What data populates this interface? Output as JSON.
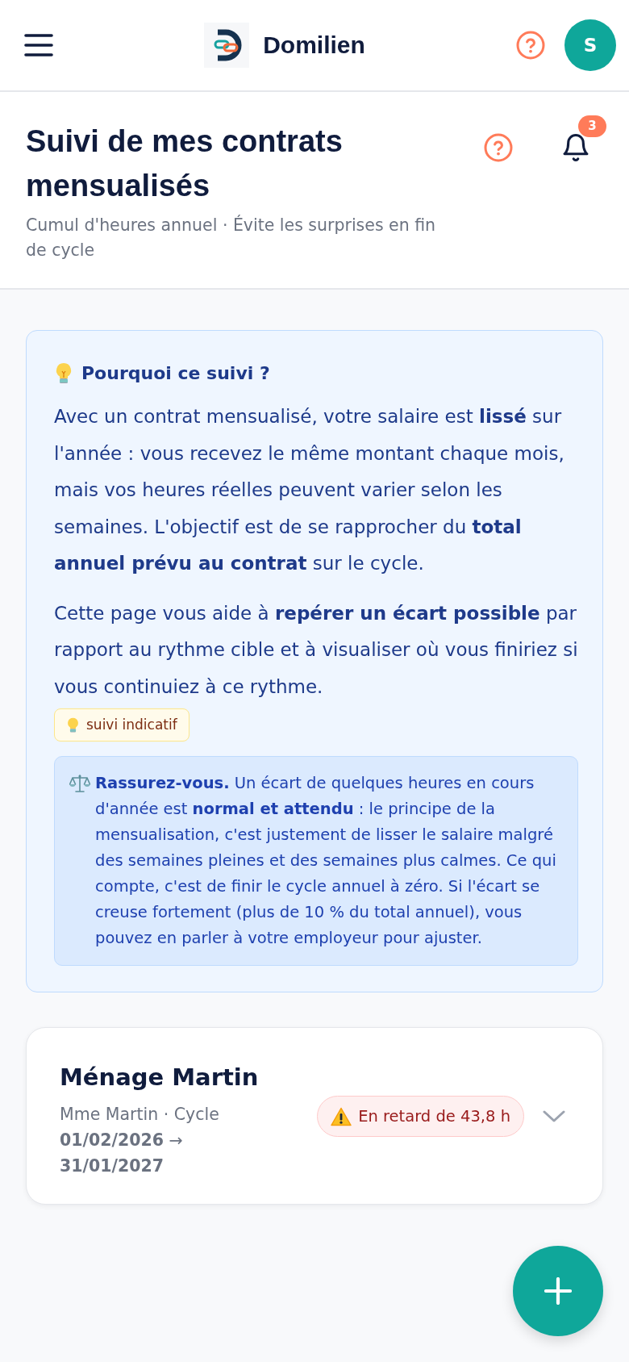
{
  "app_bar": {
    "brand": "Domilien",
    "avatar_initial": "S"
  },
  "page_header": {
    "title": "Suivi de mes contrats mensualisés",
    "subtitle": "Cumul d'heures annuel · Évite les surprises en fin de cycle",
    "notification_count": "3"
  },
  "info_card": {
    "title": "Pourquoi ce suivi ?",
    "paragraphs": [
      "Avec un contrat mensualisé, votre salaire est **lissé** sur l'année : vous recevez le même montant chaque mois, mais vos heures réelles peuvent varier selon les semaines. L'objectif est de se rapprocher du **total annuel prévu au contrat** sur le cycle.",
      "Cette page vous aide à **repérer un écart possible** par rapport au rythme cible et à visualiser où vous finiriez si vous continuiez à ce rythme."
    ],
    "tag": "suivi indicatif",
    "note": "**Rassurez-vous.** Un écart de quelques heures en cours d'année est **normal et attendu** : le principe de la mensualisation, c'est justement de lisser le salaire malgré des semaines pleines et des semaines plus calmes. Ce qui compte, c'est de finir le cycle annuel à zéro. Si l'écart se creuse fortement (plus de 10 % du total annuel), vous pouvez en parler à votre employeur pour ajuster."
  },
  "contracts": [
    {
      "name": "Ménage Martin",
      "details": "Mme Martin · Cycle **01/02/2026** → **31/01/2027**",
      "status": {
        "kind": "late",
        "text": "En retard de 43,8 h"
      },
      "expanded": false
    }
  ]
}
